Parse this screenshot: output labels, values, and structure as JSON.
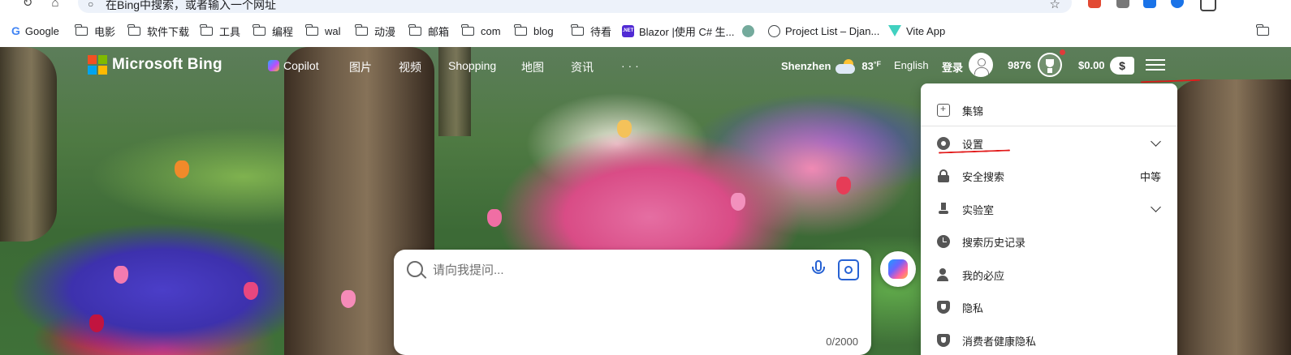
{
  "browser": {
    "address_text": "在Bing中搜索，或者输入一个网址",
    "bookmarks": [
      {
        "label": "Google",
        "icon": "google-icon"
      },
      {
        "label": "电影",
        "icon": "folder-icon"
      },
      {
        "label": "软件下载",
        "icon": "folder-icon"
      },
      {
        "label": "工具",
        "icon": "folder-icon"
      },
      {
        "label": "编程",
        "icon": "folder-icon"
      },
      {
        "label": "wal",
        "icon": "folder-icon"
      },
      {
        "label": "动漫",
        "icon": "folder-icon"
      },
      {
        "label": "邮箱",
        "icon": "folder-icon"
      },
      {
        "label": "com",
        "icon": "folder-icon"
      },
      {
        "label": "blog",
        "icon": "folder-icon"
      },
      {
        "label": "待看",
        "icon": "folder-icon"
      },
      {
        "label": "Blazor |使用 C# 生...",
        "icon": "dotnet-icon"
      },
      {
        "label": "",
        "icon": "chatgpt-icon"
      },
      {
        "label": "Project List – Djan...",
        "icon": "globe-icon"
      },
      {
        "label": "Vite App",
        "icon": "vite-icon"
      }
    ],
    "net_badge": ".NET"
  },
  "bing": {
    "brand": "Microsoft Bing",
    "nav": [
      "Copilot",
      "图片",
      "视频",
      "Shopping",
      "地图",
      "资讯",
      "· · ·"
    ],
    "location": "Shenzhen",
    "temperature": "83",
    "temp_unit": "°F",
    "language": "English",
    "login": "登录",
    "points": "9876",
    "balance": "$0.00",
    "dollar_symbol": "$"
  },
  "search": {
    "placeholder": "请向我提问...",
    "counter": "0/2000"
  },
  "menu": {
    "items": [
      {
        "label": "集锦",
        "icon": "collections-icon",
        "right": ""
      },
      {
        "label": "设置",
        "icon": "gear-icon",
        "right": ""
      },
      {
        "label": "安全搜索",
        "icon": "lock-icon",
        "right": "中等"
      },
      {
        "label": "实验室",
        "icon": "lab-icon",
        "right": ""
      },
      {
        "label": "搜索历史记录",
        "icon": "history-icon",
        "right": ""
      },
      {
        "label": "我的必应",
        "icon": "user-star-icon",
        "right": ""
      },
      {
        "label": "隐私",
        "icon": "shield-icon",
        "right": ""
      },
      {
        "label": "消费者健康隐私",
        "icon": "shield-icon",
        "right": ""
      }
    ]
  },
  "colors": {
    "annotation": "#e21b1b",
    "accent": "#2762d3"
  }
}
